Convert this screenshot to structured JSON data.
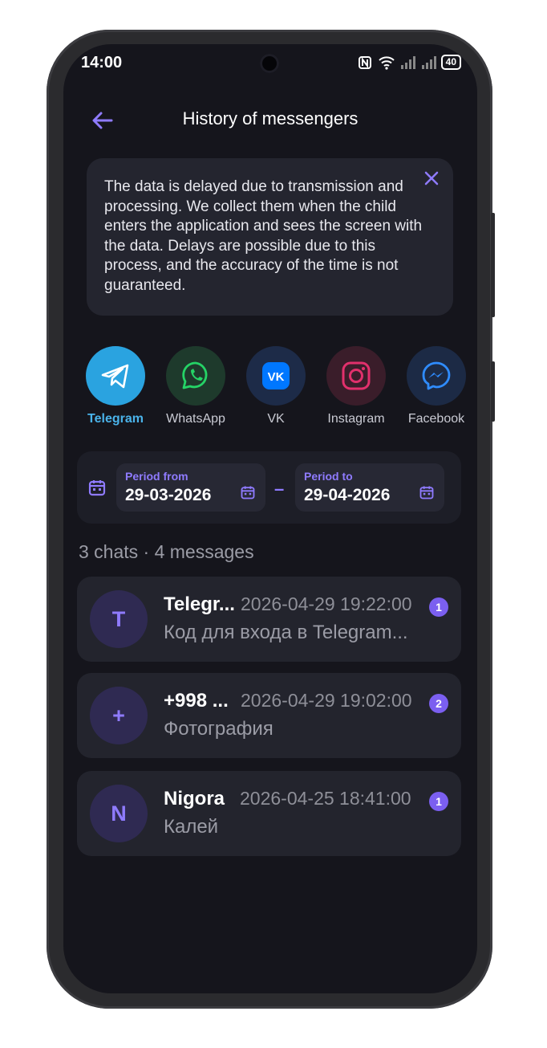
{
  "status_bar": {
    "time": "14:00",
    "battery": "40"
  },
  "header": {
    "title": "History of messengers"
  },
  "notice": {
    "text": "The data is delayed due to transmission and processing. We collect them when the child enters the application and sees the screen with the data. Delays are possible due to this process, and the accuracy of the time is not guaranteed."
  },
  "messengers": [
    {
      "label": "Telegram",
      "icon": "telegram-icon",
      "color": "#2aa3e0",
      "active": true
    },
    {
      "label": "WhatsApp",
      "icon": "whatsapp-icon",
      "color": "#25d366",
      "active": false
    },
    {
      "label": "VK",
      "icon": "vk-icon",
      "color": "#0077ff",
      "active": false
    },
    {
      "label": "Instagram",
      "icon": "instagram-icon",
      "color": "#e1306c",
      "active": false
    },
    {
      "label": "Facebook",
      "icon": "messenger-icon",
      "color": "#0084ff",
      "active": false
    }
  ],
  "period": {
    "from_label": "Period from",
    "from_value": "29-03-2026",
    "to_label": "Period to",
    "to_value": "29-04-2026",
    "separator": "–"
  },
  "summary": "3 chats · 4 messages",
  "chats": [
    {
      "avatar": "T",
      "name": "Telegr...",
      "time": "2026-04-29 19:22:00",
      "badge": "1",
      "message": "Код для входа в Telegram..."
    },
    {
      "avatar": "+",
      "name": "+998 ...",
      "time": "2026-04-29 19:02:00",
      "badge": "2",
      "message": "Фотография"
    },
    {
      "avatar": "N",
      "name": "Nigora",
      "time": "2026-04-25 18:41:00",
      "badge": "1",
      "message": "Калей"
    }
  ],
  "colors": {
    "accent": "#8f7bff",
    "background": "#15151c",
    "card": "#23242d"
  }
}
